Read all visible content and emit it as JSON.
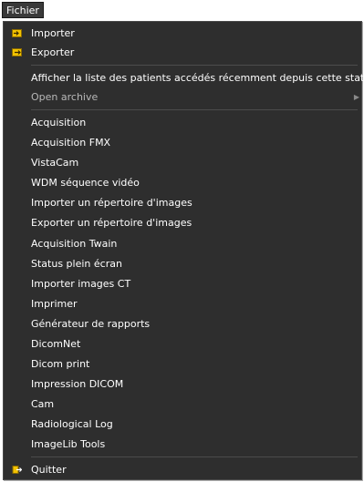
{
  "menubar": {
    "title": "Fichier"
  },
  "menu": {
    "importer": "Importer",
    "exporter": "Exporter",
    "recent_patients": "Afficher la liste des patients accédés récemment depuis cette station",
    "open_archive": "Open archive",
    "items": [
      "Acquisition",
      "Acquisition FMX",
      "VistaCam",
      "WDM séquence vidéo",
      "Importer un répertoire d'images",
      "Exporter un répertoire d'images",
      "Acquisition Twain",
      "Status plein écran",
      "Importer images CT",
      "Imprimer",
      "Générateur de rapports",
      "DicomNet",
      "Dicom print",
      "Impression DICOM",
      "Cam",
      "Radiological Log",
      "ImageLib Tools"
    ],
    "quitter": "Quitter"
  },
  "colors": {
    "menu_bg": "#2e2e2e",
    "text": "#ffffff",
    "disabled_text": "#b8b8b8",
    "icon_yellow": "#f2c200"
  }
}
